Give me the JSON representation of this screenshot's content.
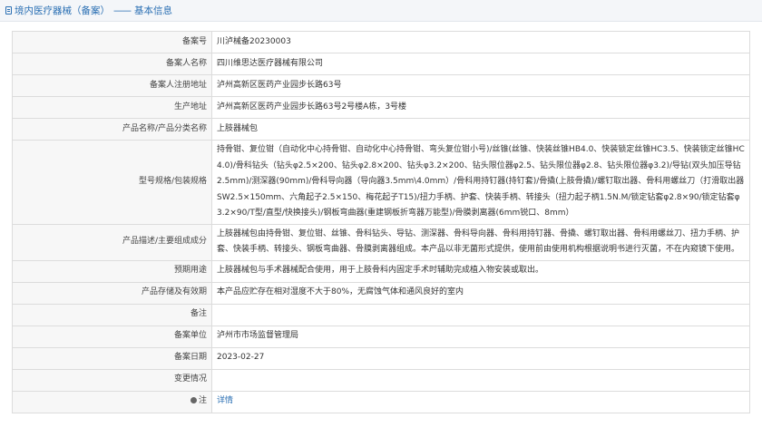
{
  "header": {
    "title": "境内医疗器械（备案）",
    "separator": "——",
    "subtitle": "基本信息"
  },
  "rows": [
    {
      "label": "备案号",
      "value": "川泸械备20230003"
    },
    {
      "label": "备案人名称",
      "value": "四川维思达医疗器械有限公司"
    },
    {
      "label": "备案人注册地址",
      "value": "泸州高新区医药产业园步长路63号"
    },
    {
      "label": "生产地址",
      "value": "泸州高新区医药产业园步长路63号2号楼A栋，3号楼"
    },
    {
      "label": "产品名称/产品分类名称",
      "value": "上肢器械包"
    },
    {
      "label": "型号规格/包装规格",
      "value": "持骨钳、复位钳（自动化中心持骨钳、自动化中心持骨钳、弯头复位钳小号)/丝锥(丝锥、快装丝锥HB4.0、快装锁定丝锥HC3.5、快装锁定丝锥HC4.0)/骨科钻头（钻头φ2.5×200、钻头φ2.8×200、钻头φ3.2×200、钻头限位器φ2.5、钻头限位器φ2.8、钻头限位器φ3.2)/导钻(双头加压导钻2.5mm)/测深器(90mm)/骨科导向器（导向器3.5mm\\4.0mm）/骨科用持钉器(持钉套)/骨撬(上肢骨撬)/螺钉取出器、骨科用螺丝刀（打滑取出器SW2.5×150mm、六角起子2.5×150、梅花起子T15)/扭力手柄、护套、快装手柄、转接头（扭力起子柄1.5N.M/锁定钻套φ2.8×90/锁定钻套φ3.2×90/T型/直型/快换接头)/钢板弯曲器(重建钢板折弯器万能型)/骨膜剥离器(6mm锐口、8mm）"
    },
    {
      "label": "产品描述/主要组成成分",
      "value": "上肢器械包由持骨钳、复位钳、丝锥、骨科钻头、导钻、测深器、骨科导向器、骨科用持钉器、骨撬、螺钉取出器、骨科用螺丝刀、扭力手柄、护套、快装手柄、转接头、钢板弯曲器、骨膜剥离器组成。本产品以非无菌形式提供，使用前由使用机构根据说明书进行灭菌，不在内窥镜下使用。"
    },
    {
      "label": "预期用途",
      "value": "上肢器械包与手术器械配合使用，用于上肢骨科内固定手术时辅助完成植入物安装或取出。"
    },
    {
      "label": "产品存储及有效期",
      "value": "本产品应贮存在相对湿度不大于80%，无腐蚀气体和通风良好的室内"
    },
    {
      "label": "备注",
      "value": ""
    },
    {
      "label": "备案单位",
      "value": "泸州市市场监督管理局"
    },
    {
      "label": "备案日期",
      "value": "2023-02-27"
    },
    {
      "label": "变更情况",
      "value": ""
    }
  ],
  "note_row": {
    "label": "注",
    "link": "详情"
  }
}
